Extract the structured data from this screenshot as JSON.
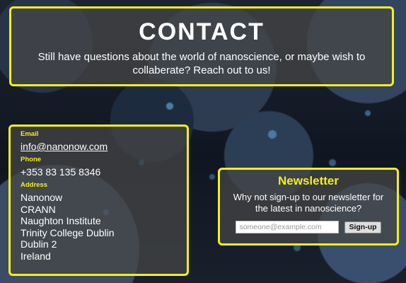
{
  "hero": {
    "title": "CONTACT",
    "subtitle": "Still have questions about the world of nanoscience, or maybe wish to collaberate? Reach out to us!"
  },
  "contact": {
    "email_label": "Email",
    "email": "info@nanonow.com",
    "phone_label": "Phone",
    "phone": "+353 83 135 8346",
    "address_label": "Address",
    "address_lines": [
      "Nanonow",
      "CRANN",
      "Naughton Institute",
      "Trinity College Dublin",
      "Dublin 2",
      "Ireland"
    ]
  },
  "newsletter": {
    "title": "Newsletter",
    "description": "Why not sign-up to our newsletter for the latest in nanoscience?",
    "email_placeholder": "someone@example.com",
    "email_value": "",
    "signup_label": "Sign-up"
  },
  "colors": {
    "accent": "#f4ef1b",
    "panel": "#464646"
  }
}
